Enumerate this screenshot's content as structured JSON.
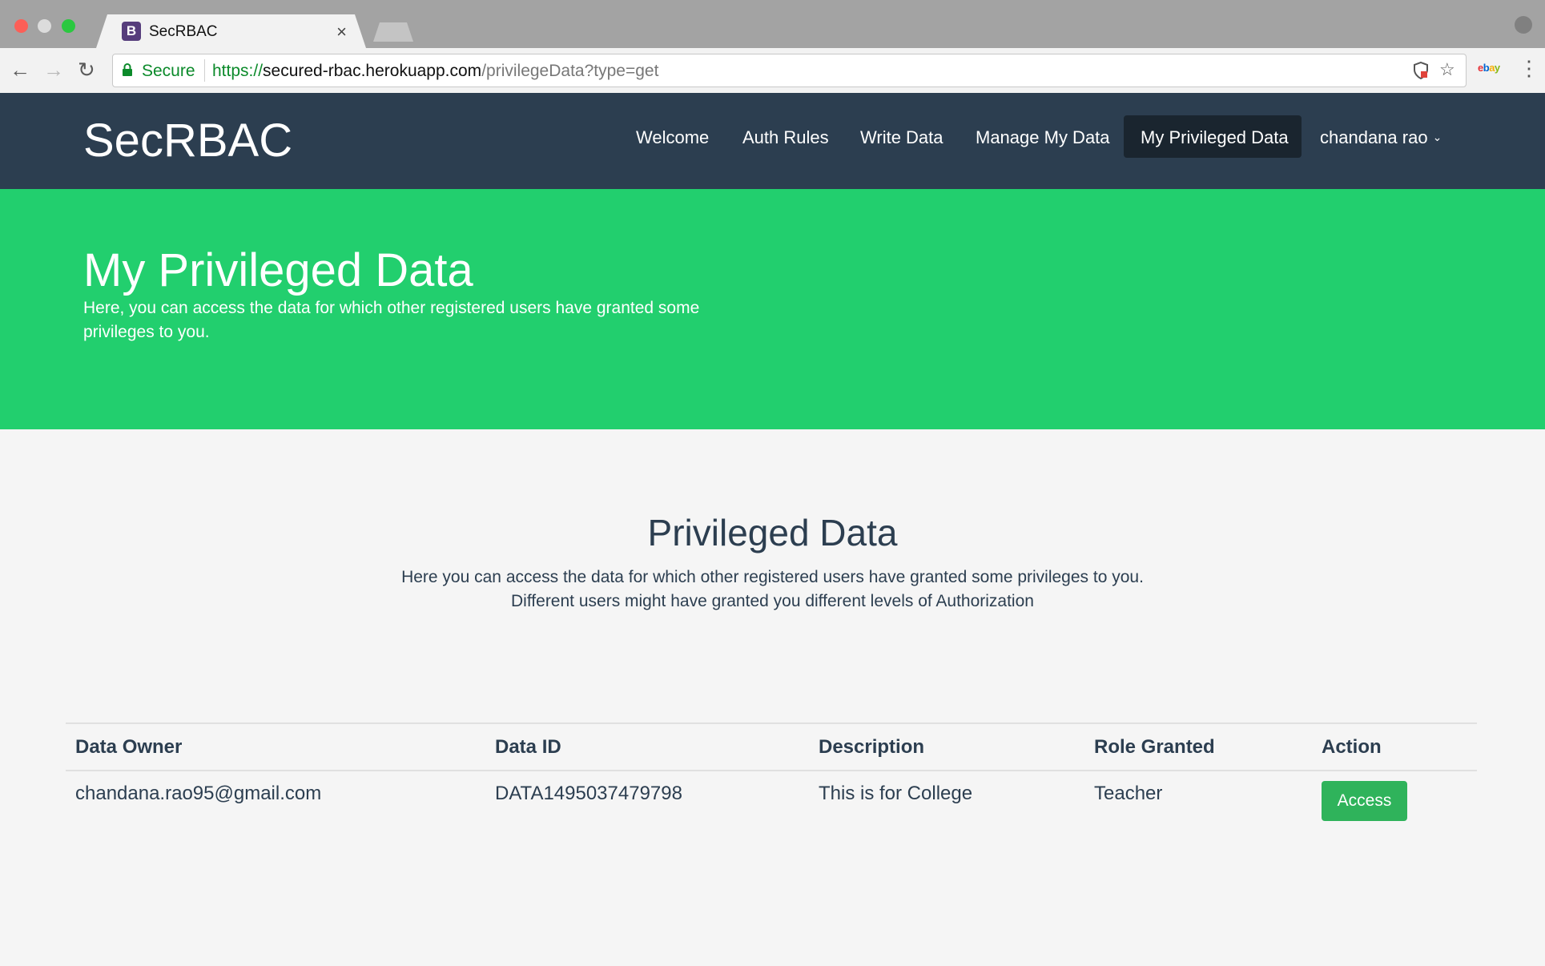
{
  "browser": {
    "tab_title": "SecRBAC",
    "tab_favicon_letter": "B",
    "tab_close": "×",
    "secure_label": "Secure",
    "url_scheme": "https://",
    "url_host": "secured-rbac.herokuapp.com",
    "url_path": "/privilegeData?type=get",
    "extension_label": "ebay",
    "icons": {
      "back": "arrow-left-icon",
      "forward": "arrow-right-icon",
      "reload": "reload-icon",
      "lock": "lock-icon",
      "shield": "shield-icon",
      "bookmark": "star-icon",
      "menu": "menu-dots-icon",
      "profile": "profile-icon"
    }
  },
  "navbar": {
    "brand": "SecRBAC",
    "items": [
      {
        "label": "Welcome"
      },
      {
        "label": "Auth Rules"
      },
      {
        "label": "Write Data"
      },
      {
        "label": "Manage My Data"
      },
      {
        "label": "My Privileged Data",
        "active": true
      }
    ],
    "user_menu": "chandana rao"
  },
  "hero": {
    "title": "My Privileged Data",
    "text_line1": "Here, you can access the data for which other registered users have granted some",
    "text_line2": "privileges to you."
  },
  "section": {
    "title": "Privileged Data",
    "text_line1": "Here you can access the data for which other registered users have granted some privileges to you.",
    "text_line2": "Different users might have granted you different levels of Authorization"
  },
  "table": {
    "headers": [
      "Data Owner",
      "Data ID",
      "Description",
      "Role Granted",
      "Action"
    ],
    "rows": [
      {
        "owner": "chandana.rao95@gmail.com",
        "data_id": "DATA1495037479798",
        "description": "This is for College",
        "role": "Teacher",
        "action_label": "Access"
      }
    ]
  },
  "colors": {
    "navbar_bg": "#2c3e50",
    "hero_bg": "#22cf6e",
    "access_button": "#2fb35b",
    "page_bg": "#f5f5f5"
  }
}
